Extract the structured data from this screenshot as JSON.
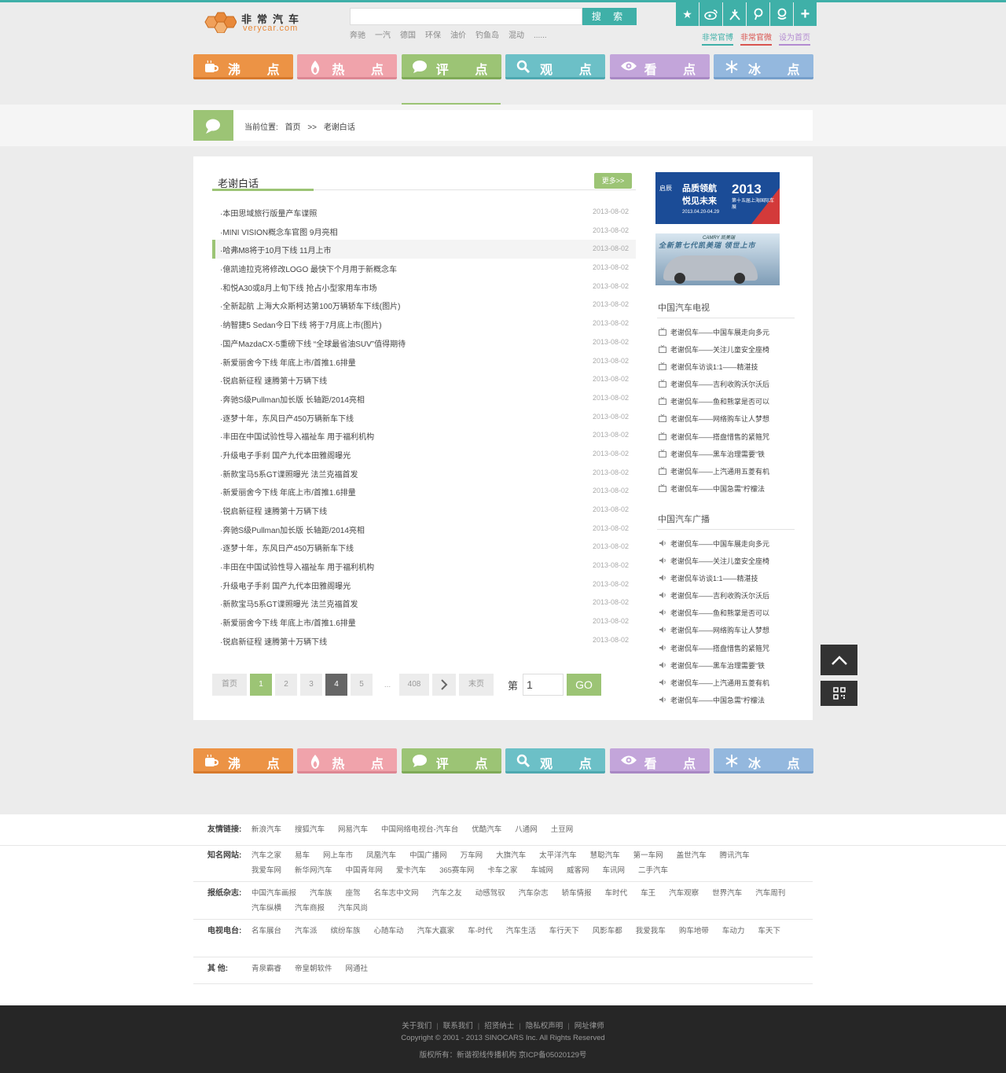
{
  "brand": {
    "name_cn": "非常汽车",
    "name_en": "verycar.com"
  },
  "search": {
    "button_label": "搜 索",
    "placeholder": "",
    "hot_words": [
      "奔驰",
      "一汽",
      "德国",
      "环保",
      "油价",
      "钓鱼岛",
      "混动",
      "......"
    ]
  },
  "social_icons": [
    "star-icon",
    "weibo-icon",
    "renren-icon",
    "pin-icon",
    "tencent-icon",
    "plus-icon"
  ],
  "top_links": [
    {
      "label": "非常官博",
      "color": "#3fb0a8"
    },
    {
      "label": "非常官微",
      "color": "#d9534f"
    },
    {
      "label": "设为首页",
      "color": "#b38bd1"
    }
  ],
  "nav": [
    {
      "label": "沸 点",
      "icon": "cup-icon"
    },
    {
      "label": "热 点",
      "icon": "flame-icon"
    },
    {
      "label": "评 点",
      "icon": "chat-icon"
    },
    {
      "label": "观 点",
      "icon": "search-icon"
    },
    {
      "label": "看 点",
      "icon": "eye-icon"
    },
    {
      "label": "冰 点",
      "icon": "snowflake-icon"
    }
  ],
  "breadcrumb": {
    "prefix": "当前位置:",
    "home": "首页",
    "sep": ">>",
    "current": "老谢白话"
  },
  "list": {
    "title": "老谢白话",
    "more_label": "更多>>",
    "items": [
      {
        "title": "·本田思域旅行版量产车谍照",
        "date": "2013-08-02"
      },
      {
        "title": "·MINI VISION概念车官图 9月亮相",
        "date": "2013-08-02"
      },
      {
        "title": "·哈弗M8将于10月下线 11月上市",
        "date": "2013-08-02"
      },
      {
        "title": "·億凯迪拉克将修改LOGO 最快下个月用于新概念车",
        "date": "2013-08-02"
      },
      {
        "title": "·和悦A30或8月上旬下线 抢占小型家用车市场",
        "date": "2013-08-02"
      },
      {
        "title": "·全新起航 上海大众斯柯达第100万辆轿车下线(图片)",
        "date": "2013-08-02"
      },
      {
        "title": "·纳智捷5 Sedan今日下线 将于7月底上市(图片)",
        "date": "2013-08-02"
      },
      {
        "title": "·国产MazdaCX-5重磅下线 “全球最省油SUV”值得期待",
        "date": "2013-08-02"
      },
      {
        "title": "·新爱丽舍今下线 年底上市/首推1.6排量",
        "date": "2013-08-02"
      },
      {
        "title": "·锐启新征程 速腾第十万辆下线",
        "date": "2013-08-02"
      },
      {
        "title": "·奔驰S级Pullman加长版 长轴距/2014亮相",
        "date": "2013-08-02"
      },
      {
        "title": "·逐梦十年，东风日产450万辆新车下线",
        "date": "2013-08-02"
      },
      {
        "title": "·丰田在中国试验性导入福祉车 用于福利机构",
        "date": "2013-08-02"
      },
      {
        "title": "·升级电子手刹 国产九代本田雅阁曝光",
        "date": "2013-08-02"
      },
      {
        "title": "·新款宝马5系GT谍照曝光 法兰克福首发",
        "date": "2013-08-02"
      },
      {
        "title": "·新爱丽舍今下线 年底上市/首推1.6排量",
        "date": "2013-08-02"
      },
      {
        "title": "·锐启新征程 速腾第十万辆下线",
        "date": "2013-08-02"
      },
      {
        "title": "·奔驰S级Pullman加长版 长轴距/2014亮相",
        "date": "2013-08-02"
      },
      {
        "title": "·逐梦十年，东风日产450万辆新车下线",
        "date": "2013-08-02"
      },
      {
        "title": "·丰田在中国试验性导入福祉车 用于福利机构",
        "date": "2013-08-02"
      },
      {
        "title": "·升级电子手刹 国产九代本田雅阁曝光",
        "date": "2013-08-02"
      },
      {
        "title": "·新款宝马5系GT谍照曝光 法兰克福首发",
        "date": "2013-08-02"
      },
      {
        "title": "·新爱丽舍今下线 年底上市/首推1.6排量",
        "date": "2013-08-02"
      },
      {
        "title": "·锐启新征程 速腾第十万辆下线",
        "date": "2013-08-02"
      }
    ]
  },
  "pager": {
    "first": "首页",
    "pages": [
      "1",
      "2",
      "3",
      "4",
      "5"
    ],
    "ellipsis": "...",
    "last_page": "408",
    "last": "末页",
    "goto_prefix": "第",
    "input_value": "1",
    "go_label": "GO"
  },
  "ads": {
    "ad1": {
      "brand": "启辰",
      "line1": "品质领航",
      "line2": "悦见未来",
      "year": "2013",
      "event": "第十五届上海国际车展",
      "dates": "2013.04.20-04.29"
    },
    "ad2": {
      "brand": "CAMRY 凯美瑞",
      "text": "全新第七代凯美瑞 领世上市"
    }
  },
  "sidebar": {
    "tv": {
      "title": "中国汽车电视",
      "items": [
        "老谢侃车——中国车展走向多元",
        "老谢侃车——关注儿童安全座椅",
        "老谢侃车访谈1:1——精湛技",
        "老谢侃车——吉利收购沃尔沃后",
        "老谢侃车——鱼和熊掌是否可以",
        "老谢侃车——网络购车让人梦想",
        "老谢侃车——搭盘惜售的紧箍咒",
        "老谢侃车——黑车治理需要“铁",
        "老谢侃车——上汽通用五菱有机",
        "老谢侃车——中国急需“柠檬法"
      ]
    },
    "radio": {
      "title": "中国汽车广播",
      "items": [
        "老谢侃车——中国车展走向多元",
        "老谢侃车——关注儿童安全座椅",
        "老谢侃车访谈1:1——精湛技",
        "老谢侃车——吉利收购沃尔沃后",
        "老谢侃车——鱼和熊掌是否可以",
        "老谢侃车——网络购车让人梦想",
        "老谢侃车——搭盘惜售的紧箍咒",
        "老谢侃车——黑车治理需要“铁",
        "老谢侃车——上汽通用五菱有机",
        "老谢侃车——中国急需“柠檬法"
      ]
    }
  },
  "footer_links": [
    {
      "label": "友情链接:",
      "links": [
        "新浪汽车",
        "搜狐汽车",
        "网易汽车",
        "中国网络电视台-汽车台",
        "优酷汽车",
        "八通网",
        "土豆网"
      ]
    },
    {
      "label": "知名网站:",
      "links": [
        "汽车之家",
        "易车",
        "网上车市",
        "凤凰汽车",
        "中国广播网",
        "万车网",
        "大旗汽车",
        "太平洋汽车",
        "慧聪汽车",
        "第一车网",
        "盖世汽车",
        "腾讯汽车",
        "我爱车网",
        "新华网汽车",
        "中国青年网",
        "爱卡汽车",
        "365赛车网",
        "卡车之家",
        "车城网",
        "威客网",
        "车讯网",
        "二手汽车"
      ]
    },
    {
      "label": "报纸杂志:",
      "links": [
        "中国汽车画报",
        "汽车族",
        "座驾",
        "名车志中文网",
        "汽车之友",
        "动感驾驭",
        "汽车杂志",
        "轿车情报",
        "车时代",
        "车王",
        "汽车观察",
        "世界汽车",
        "汽车周刊",
        "汽车纵横",
        "汽车商报",
        "汽车风尚"
      ]
    },
    {
      "label": "电视电台:",
      "links": [
        "名车展台",
        "汽车派",
        "缤纷车族",
        "心随车动",
        "汽车大赢家",
        "车-时代",
        "汽车生活",
        "车行天下",
        "风影车都",
        "我爱我车",
        "购车地带",
        "车动力",
        "车天下"
      ]
    },
    {
      "label": "其  他:",
      "links": [
        "青泉霸睿",
        "帝皇朝软件",
        "网通社"
      ]
    }
  ],
  "copyright": {
    "links": [
      "关于我们",
      "联系我们",
      "招贤纳士",
      "隐私权声明",
      "网址律师"
    ],
    "line2": "Copyright © 2001 - 2013 SINOCARS Inc. All Rights Reserved",
    "line3": "版权所有：新谐视线传播机构  京ICP备05020129号"
  }
}
